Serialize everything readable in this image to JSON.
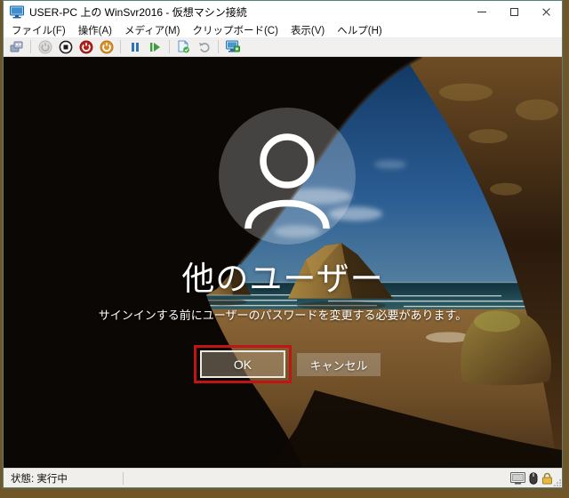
{
  "window": {
    "title": "USER-PC 上の WinSvr2016 - 仮想マシン接続",
    "app_icon": "vm-monitor-icon",
    "controls": [
      "minimize",
      "maximize",
      "close"
    ]
  },
  "menu_bar": {
    "items": [
      "ファイル(F)",
      "操作(A)",
      "メディア(M)",
      "クリップボード(C)",
      "表示(V)",
      "ヘルプ(H)"
    ]
  },
  "toolbar": {
    "buttons": [
      "ctrl-alt-del",
      "start",
      "turn-off",
      "shut-down",
      "save",
      "pause",
      "reset",
      "checkpoint",
      "revert",
      "enhanced-session"
    ]
  },
  "login_screen": {
    "user_title": "他のユーザー",
    "message": "サインインする前にユーザーのパスワードを変更する必要があります。",
    "ok_button": "OK",
    "cancel_button": "キャンセル",
    "avatar": "user-silhouette-icon"
  },
  "annotation": {
    "shape": "rectangle",
    "color": "#c11414",
    "target": "ok-button"
  },
  "status_bar": {
    "status": "状態: 実行中",
    "icons": [
      "display-icon",
      "mouse-icon",
      "lock-icon"
    ]
  },
  "colors": {
    "window_border": "#56807a",
    "desktop_background": "#71562a",
    "annotation_red": "#c11414"
  }
}
